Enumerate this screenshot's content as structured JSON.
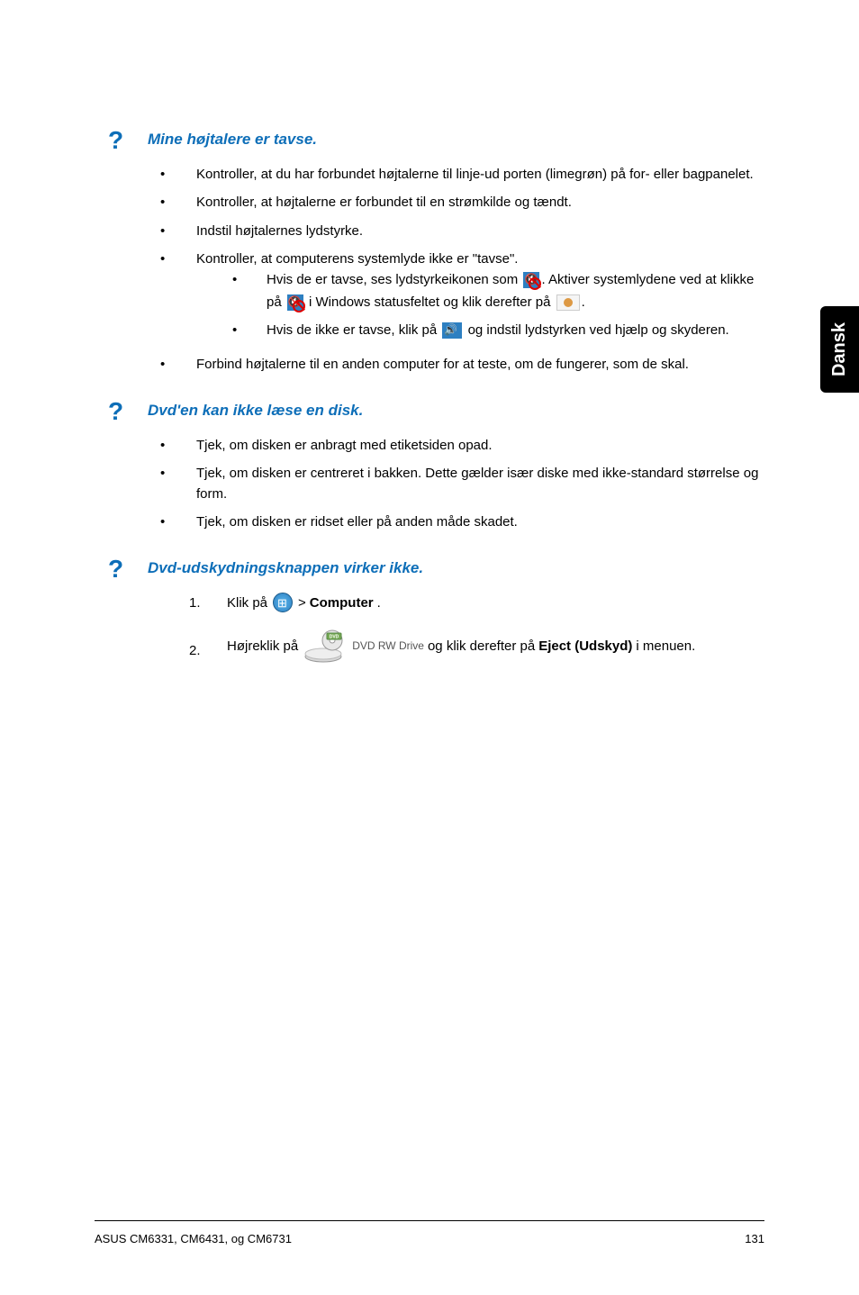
{
  "sideTab": "Dansk",
  "questions": [
    {
      "title": "Mine højtalere er tavse.",
      "bullets": [
        {
          "text": "Kontroller, at du har forbundet højtalerne til linje-ud porten (limegrøn) på for- eller bagpanelet."
        },
        {
          "text": "Kontroller, at højtalerne er forbundet til en strømkilde og tændt."
        },
        {
          "text": "Indstil højtalernes lydstyrke."
        },
        {
          "text": "Kontroller, at computerens systemlyde ikke er \"tavse\".",
          "sub": [
            {
              "parts": [
                "Hvis de er tavse, ses lydstyrkeikonen som ",
                "ICON_MUTE",
                ". Aktiver systemlydene ved at klikke på ",
                "ICON_MUTE2",
                " i Windows statusfeltet og klik derefter på ",
                "ICON_MIXER",
                "."
              ]
            },
            {
              "parts": [
                "Hvis de ikke er tavse, klik på ",
                "ICON_SPEAKER",
                " og indstil lydstyrken ved hjælp og skyderen."
              ]
            }
          ]
        },
        {
          "text": "Forbind højtalerne til en anden computer for at teste, om de fungerer, som de skal."
        }
      ]
    },
    {
      "title": "Dvd'en kan ikke læse en disk.",
      "bullets": [
        {
          "text": "Tjek, om disken er anbragt med etiketsiden opad."
        },
        {
          "text": "Tjek, om disken er centreret i bakken. Dette gælder især diske med ikke-standard størrelse og form."
        },
        {
          "text": "Tjek, om disken er ridset eller på anden måde skadet."
        }
      ]
    },
    {
      "title": "Dvd-udskydningsknappen virker ikke.",
      "numbered": [
        {
          "num": "1.",
          "parts": [
            "Klik på ",
            "ICON_START",
            " > ",
            "BOLD:Computer",
            "."
          ]
        },
        {
          "num": "2.",
          "parts": [
            "Højreklik på ",
            "ICON_DVD",
            " og klik derefter på ",
            "BOLD:Eject (Udskyd)",
            " i menuen."
          ]
        }
      ]
    }
  ],
  "dvdDriveLabel": "DVD RW Drive",
  "footer": {
    "left": "ASUS CM6331, CM6431, og CM6731",
    "right": "131"
  }
}
